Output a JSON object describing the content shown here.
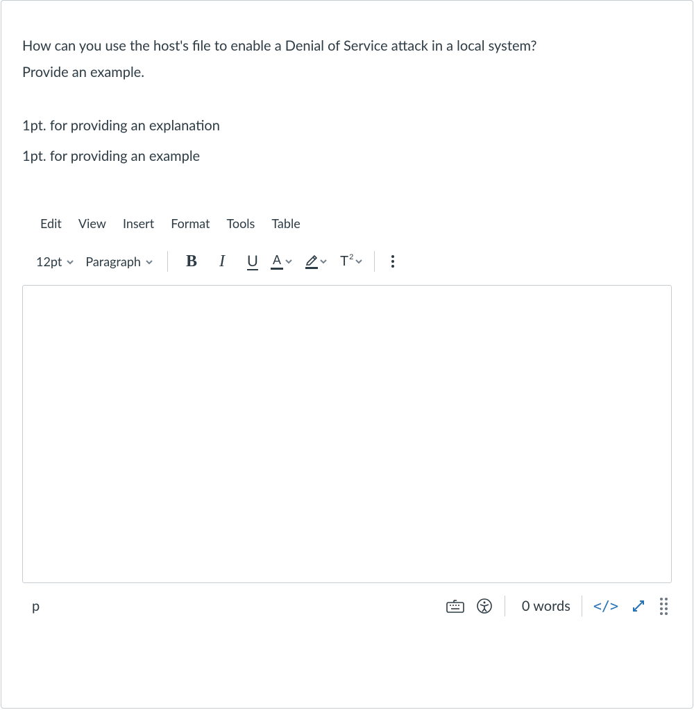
{
  "question": {
    "line1": "How can you use the host's file to enable a Denial of Service attack in a local system?",
    "line2": "Provide an example.",
    "rubric1": "1pt. for providing an explanation",
    "rubric2": "1pt. for providing an example"
  },
  "editor": {
    "menubar": {
      "edit": "Edit",
      "view": "View",
      "insert": "Insert",
      "format": "Format",
      "tools": "Tools",
      "table": "Table"
    },
    "toolbar": {
      "font_size": "12pt",
      "block_format": "Paragraph"
    },
    "statusbar": {
      "path": "p",
      "word_count": "0 words",
      "code_label": "</>"
    }
  },
  "icons": {
    "bold": "B",
    "italic": "I",
    "underline": "U",
    "textcolor_A": "A",
    "superscript_T": "T",
    "superscript_2": "2"
  }
}
